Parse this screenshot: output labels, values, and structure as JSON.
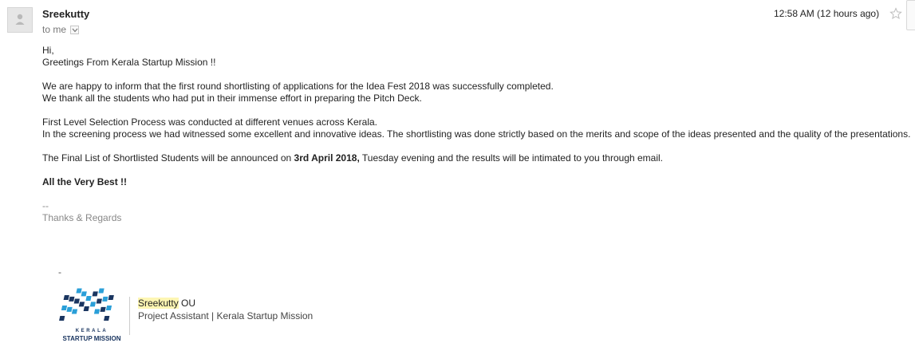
{
  "header": {
    "sender_name": "Sreekutty",
    "to_label": "to me",
    "timestamp": "12:58 AM (12 hours ago)"
  },
  "body": {
    "greeting": "Hi,",
    "greeting2": "Greetings From Kerala Startup Mission !!",
    "para1_line1": "We are happy to inform that the first round shortlisting of applications for the Idea Fest 2018 was successfully completed.",
    "para1_line2": "We thank all the students who had put in their immense effort in preparing the Pitch Deck.",
    "para2_line1": "First Level Selection Process was conducted at different venues across Kerala.",
    "para2_line2": "In the screening process we had witnessed some excellent and innovative ideas. The shortlisting was done strictly based on the merits and scope of the ideas presented and the quality of the presentations.",
    "para3_before": "The Final List of Shortlisted Students will be announced on ",
    "para3_bold": "3rd April 2018,",
    "para3_after": " Tuesday evening and the results will be intimated to you through email.",
    "closing_bold": "All the Very Best !!",
    "separator": "--",
    "regards": "Thanks & Regards"
  },
  "signature": {
    "dash": "-",
    "logo_line1": "KERALA",
    "logo_line2": "STARTUP MISSION",
    "name_highlight": "Sreekutty",
    "name_rest": " OU",
    "title": "Project Assistant | Kerala Startup Mission"
  },
  "colors": {
    "logo_blue": "#2a9fd8",
    "logo_dark": "#1a3560",
    "highlight": "#fdf6b3"
  },
  "icons": [
    "avatar-icon",
    "chevron-down-icon",
    "star-icon",
    "kerala-startup-mission-logo"
  ]
}
